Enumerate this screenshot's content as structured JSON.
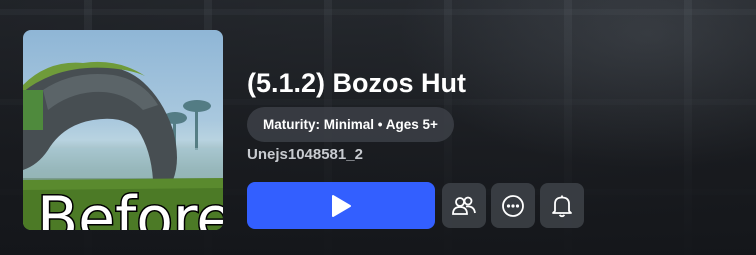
{
  "thumbnail": {
    "caption": "Before",
    "alt_icon": "game-thumbnail"
  },
  "game": {
    "title": "(5.1.2) Bozos Hut",
    "maturity_label": "Maturity: Minimal • Ages 5+",
    "creator": "Unejs1048581_2"
  },
  "actions": {
    "play_icon": "play-icon",
    "friends_icon": "friends-icon",
    "more_icon": "more-options-icon",
    "notify_icon": "bell-icon"
  },
  "colors": {
    "play_button": "#335fff",
    "icon_button": "#3c4046",
    "background": "#1b1d21"
  }
}
